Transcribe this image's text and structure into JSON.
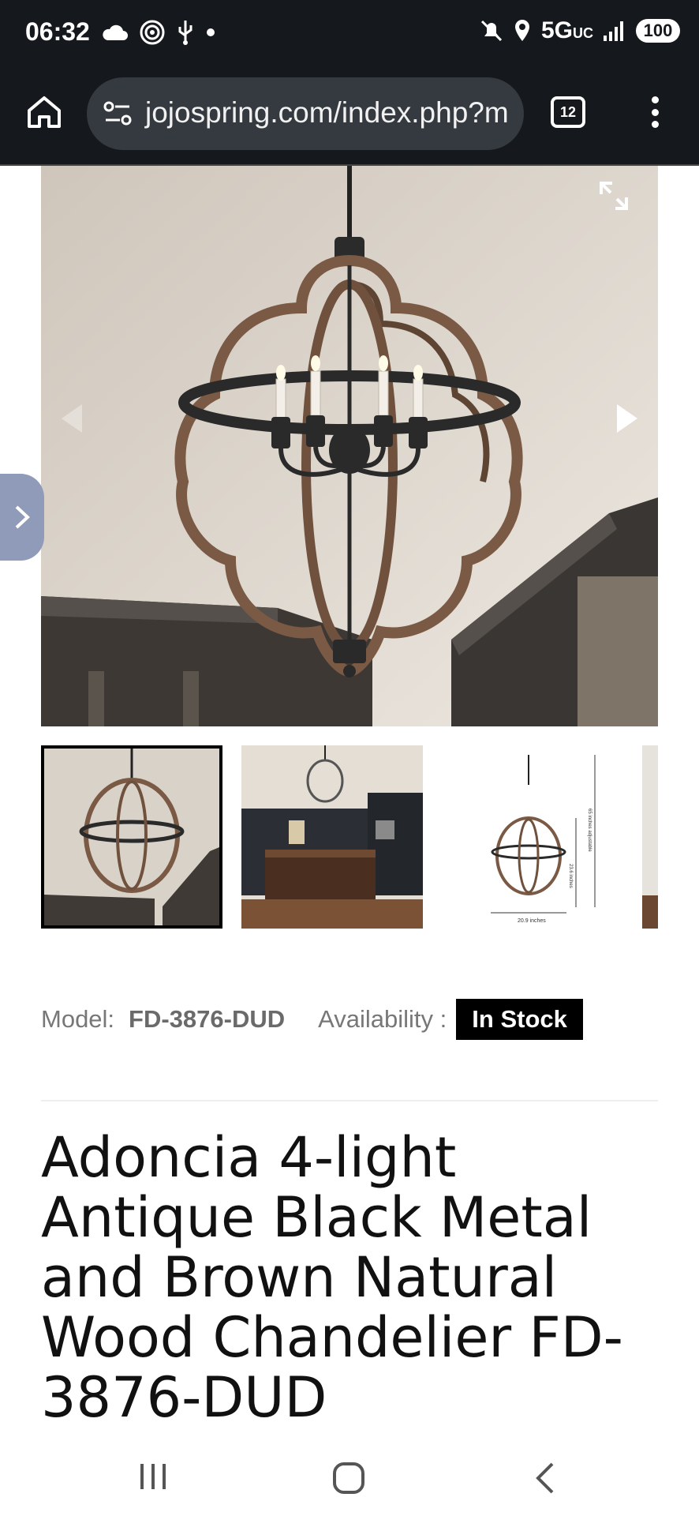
{
  "status_bar": {
    "time": "06:32",
    "network": "5G",
    "network_sub": "UC",
    "battery": "100"
  },
  "browser": {
    "url": "jojospring.com/index.php?m",
    "tab_count": "12"
  },
  "gallery": {
    "thumbnails": [
      {
        "name": "thumb-chandelier-ceiling",
        "active": true
      },
      {
        "name": "thumb-kitchen-room",
        "active": false
      },
      {
        "name": "thumb-dimensions",
        "active": false
      },
      {
        "name": "thumb-partial",
        "active": false
      }
    ],
    "dimension_labels": {
      "width": "20.9 inches",
      "height": "23.6 inches",
      "chain": "65 inches adjustable"
    }
  },
  "product": {
    "model_label": "Model:",
    "model_value": "FD-3876-DUD",
    "availability_label": "Availability :",
    "availability_value": "In Stock",
    "title": "Adoncia 4-light Antique Black Metal and Brown Natural Wood Chandelier FD-3876-DUD"
  },
  "icons": {
    "status_left": [
      "cloud-icon",
      "hotspot-icon",
      "usb-icon",
      "dot-icon"
    ],
    "status_right": [
      "mute-icon",
      "location-icon",
      "signal-icon",
      "battery-icon"
    ],
    "browser": [
      "home-icon",
      "site-settings-icon",
      "tabs-icon",
      "more-icon"
    ],
    "gallery": [
      "expand-icon",
      "prev-arrow-icon",
      "next-arrow-icon",
      "chevron-right-icon"
    ],
    "nav": [
      "recents-icon",
      "home-nav-icon",
      "back-icon"
    ]
  },
  "colors": {
    "status_bar": "#15181c",
    "url_box": "#353a40",
    "badge_bg": "#000000",
    "side_tab": "#8f9bb8"
  }
}
